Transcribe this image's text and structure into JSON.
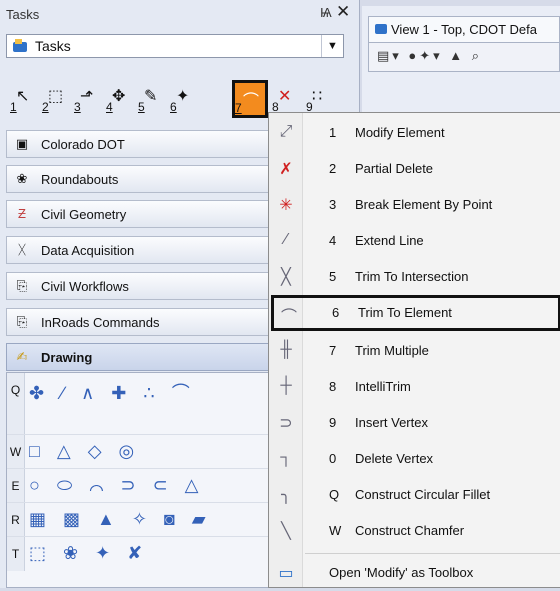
{
  "tasks_pane": {
    "title": "Tasks",
    "pin_glyph": "Ѩ",
    "close_glyph": "✕",
    "selected_task": "Tasks",
    "toolbar": [
      {
        "num": "1",
        "icon": "select-arrow-icon",
        "glyph": "↖"
      },
      {
        "num": "2",
        "icon": "dashed-selection-icon",
        "glyph": "⬚"
      },
      {
        "num": "3",
        "icon": "manipulate-icon",
        "glyph": "⬏"
      },
      {
        "num": "4",
        "icon": "move-icon",
        "glyph": "✥"
      },
      {
        "num": "5",
        "icon": "attributes-icon",
        "glyph": "✎"
      },
      {
        "num": "6",
        "icon": "measure-icon",
        "glyph": "✦"
      },
      {
        "num": "7",
        "icon": "modify-icon",
        "glyph": "⌒"
      },
      {
        "num": "8",
        "icon": "delete-icon",
        "glyph": "✕"
      },
      {
        "num": "9",
        "icon": "group-icon",
        "glyph": "∷"
      }
    ],
    "categories": [
      {
        "label": "Colorado DOT",
        "icon": "cdot-icon",
        "glyph": "▣"
      },
      {
        "label": "Roundabouts",
        "icon": "roundabout-icon",
        "glyph": "❀"
      },
      {
        "label": "Civil Geometry",
        "icon": "civil-geometry-icon",
        "glyph": "Ƶ"
      },
      {
        "label": "Data Acquisition",
        "icon": "survey-icon",
        "glyph": "ᚷ"
      },
      {
        "label": "Civil Workflows",
        "icon": "workflows-icon",
        "glyph": "⎘"
      },
      {
        "label": "InRoads Commands",
        "icon": "inroads-icon",
        "glyph": "⎘"
      },
      {
        "label": "Drawing",
        "icon": "drawing-icon",
        "glyph": "✍"
      }
    ],
    "drawing_rows": [
      {
        "key": "Q",
        "icons": "✤ ∕ ∧ ✚ ∴ ⌒"
      },
      {
        "key": "W",
        "icons": "□ △ ◇ ◎"
      },
      {
        "key": "E",
        "icons": "○ ⬭ ⌒ ⊃ ⊂ △"
      },
      {
        "key": "R",
        "icons": "▦ ▩ ▲ ✧ ◙ ▰"
      },
      {
        "key": "T",
        "icons": "⬚ ❀ ✦ ✘"
      }
    ]
  },
  "view": {
    "tab_title": "View 1 - Top, CDOT Defa",
    "toolbar_glyphs": "▤▾ ●✦▾ ▲ ⌕"
  },
  "menu": {
    "items": [
      {
        "key": "1",
        "label": "Modify Element",
        "icon": "modify-element-icon",
        "glyph": "⤢"
      },
      {
        "key": "2",
        "label": "Partial Delete",
        "icon": "partial-delete-icon",
        "glyph": "✗"
      },
      {
        "key": "3",
        "label": "Break Element By Point",
        "icon": "break-element-icon",
        "glyph": "✳"
      },
      {
        "key": "4",
        "label": "Extend Line",
        "icon": "extend-line-icon",
        "glyph": "∕"
      },
      {
        "key": "5",
        "label": "Trim To Intersection",
        "icon": "trim-intersection-icon",
        "glyph": "╳"
      },
      {
        "key": "6",
        "label": "Trim To Element",
        "icon": "trim-element-icon",
        "glyph": "⌒"
      },
      {
        "key": "7",
        "label": "Trim Multiple",
        "icon": "trim-multiple-icon",
        "glyph": "╫"
      },
      {
        "key": "8",
        "label": "IntelliTrim",
        "icon": "intellitrim-icon",
        "glyph": "┼"
      },
      {
        "key": "9",
        "label": "Insert Vertex",
        "icon": "insert-vertex-icon",
        "glyph": "⊃"
      },
      {
        "key": "0",
        "label": "Delete Vertex",
        "icon": "delete-vertex-icon",
        "glyph": "┐"
      },
      {
        "key": "Q",
        "label": "Construct Circular Fillet",
        "icon": "circular-fillet-icon",
        "glyph": "╮"
      },
      {
        "key": "W",
        "label": "Construct Chamfer",
        "icon": "chamfer-icon",
        "glyph": "╲"
      }
    ],
    "footer_label": "Open 'Modify' as Toolbox",
    "footer_glyph": "▭"
  }
}
